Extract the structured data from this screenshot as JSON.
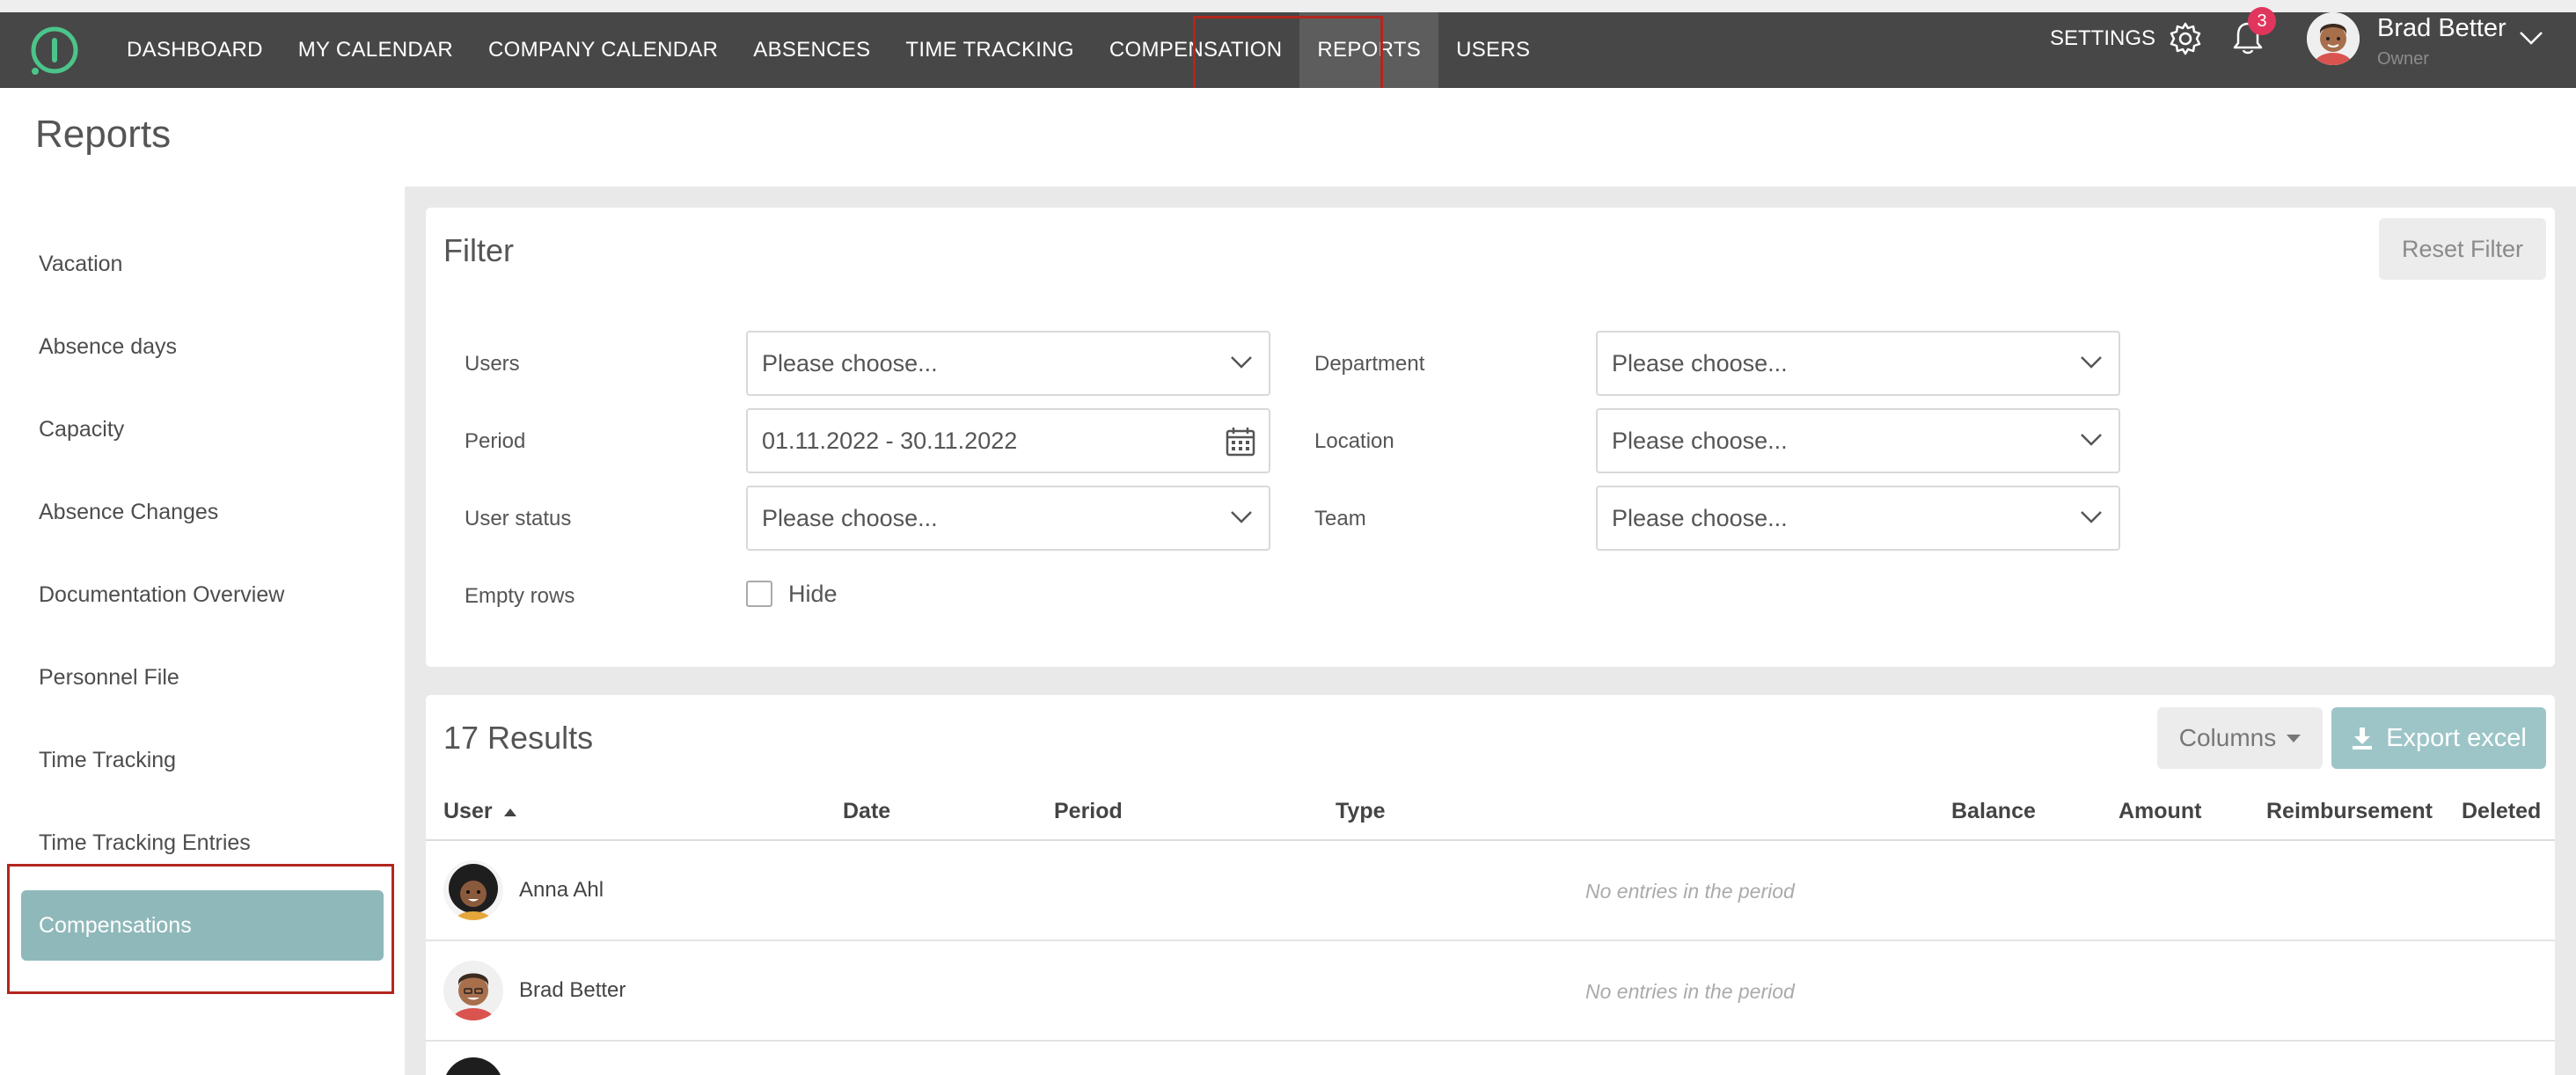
{
  "nav": {
    "items": [
      "DASHBOARD",
      "MY CALENDAR",
      "COMPANY CALENDAR",
      "ABSENCES",
      "TIME TRACKING",
      "COMPENSATION",
      "REPORTS",
      "USERS"
    ],
    "active": "REPORTS",
    "settings_label": "SETTINGS",
    "notification_count": "3",
    "user_name": "Brad Better",
    "user_role": "Owner"
  },
  "page": {
    "title": "Reports"
  },
  "sidebar": {
    "items": [
      "Vacation",
      "Absence days",
      "Capacity",
      "Absence Changes",
      "Documentation Overview",
      "Personnel File",
      "Time Tracking",
      "Time Tracking Entries",
      "Compensations"
    ],
    "active": "Compensations"
  },
  "filter": {
    "title": "Filter",
    "reset_label": "Reset Filter",
    "users_label": "Users",
    "users_value": "Please choose...",
    "period_label": "Period",
    "period_value": "01.11.2022 - 30.11.2022",
    "user_status_label": "User status",
    "user_status_value": "Please choose...",
    "empty_rows_label": "Empty rows",
    "hide_label": "Hide",
    "department_label": "Department",
    "department_value": "Please choose...",
    "location_label": "Location",
    "location_value": "Please choose...",
    "team_label": "Team",
    "team_value": "Please choose..."
  },
  "results": {
    "title": "17 Results",
    "columns_label": "Columns",
    "export_label": "Export excel",
    "headers": [
      "User",
      "Date",
      "Period",
      "Type",
      "Balance",
      "Amount",
      "Reimbursement",
      "Deleted"
    ],
    "rows": [
      {
        "name": "Anna Ahl",
        "note": "No entries in the period"
      },
      {
        "name": "Brad Better",
        "note": "No entries in the period"
      }
    ]
  },
  "colors": {
    "navbar": "#474747",
    "accent": "#8fb8ba",
    "badge": "#e0365d",
    "highlight": "#b3261e"
  }
}
